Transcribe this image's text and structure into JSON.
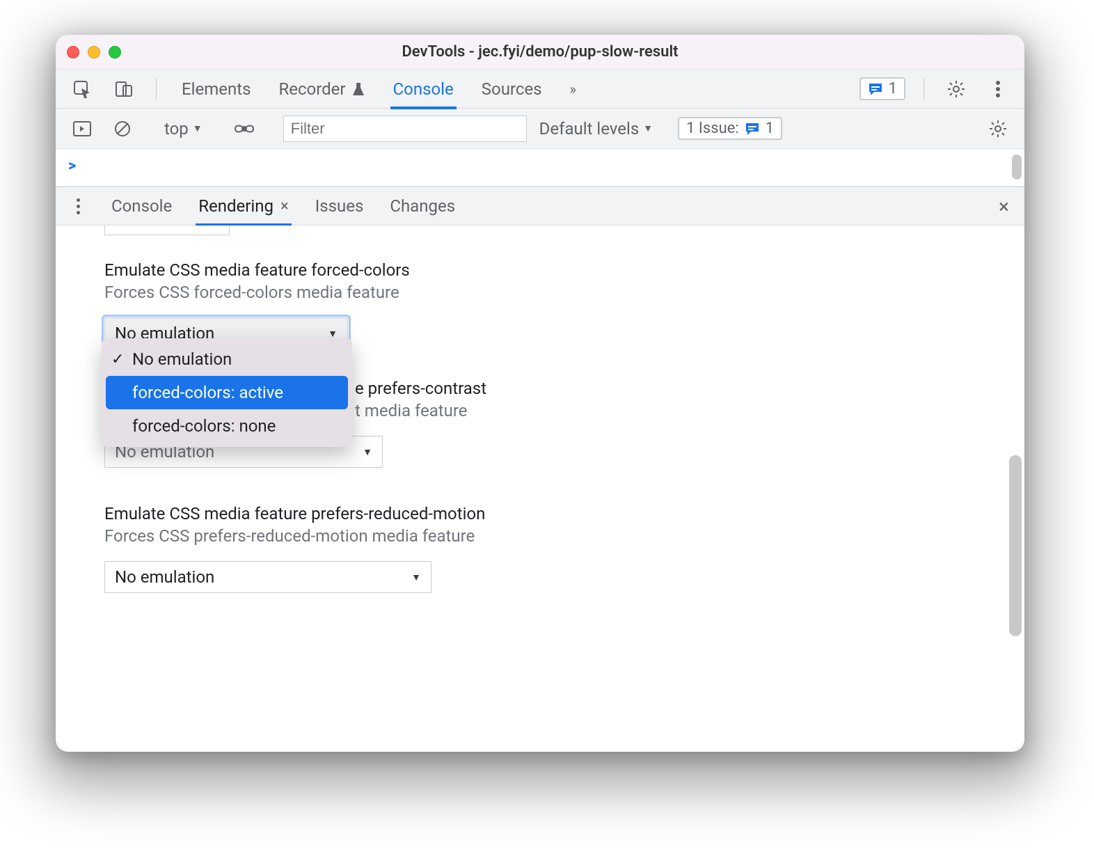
{
  "window": {
    "title": "DevTools - jec.fyi/demo/pup-slow-result"
  },
  "tabs": {
    "elements": "Elements",
    "recorder": "Recorder",
    "console": "Console",
    "sources": "Sources",
    "more_glyph": "»",
    "issues_count": "1"
  },
  "console_toolbar": {
    "context": "top",
    "filter_placeholder": "Filter",
    "levels": "Default levels",
    "issues_label": "1 Issue:",
    "issues_count": "1"
  },
  "drawer_tabs": {
    "console": "Console",
    "rendering": "Rendering",
    "issues": "Issues",
    "changes": "Changes"
  },
  "rendering": {
    "forced_colors": {
      "title": "Emulate CSS media feature forced-colors",
      "desc": "Forces CSS forced-colors media feature",
      "value": "No emulation",
      "options": [
        "No emulation",
        "forced-colors: active",
        "forced-colors: none"
      ],
      "selected_index": 0,
      "highlight_index": 1
    },
    "prefers_contrast": {
      "title_suffix": "e prefers-contrast",
      "desc_suffix": "t media feature",
      "value": "No emulation"
    },
    "prefers_reduced_motion": {
      "title": "Emulate CSS media feature prefers-reduced-motion",
      "desc": "Forces CSS prefers-reduced-motion media feature",
      "value": "No emulation"
    }
  },
  "glyphs": {
    "check": "✓",
    "triangle_down": "▼",
    "close": "×",
    "chevrons": "»",
    "caret": ">"
  },
  "colors": {
    "accent": "#1a73e8",
    "text": "#202124",
    "muted": "#5f6368",
    "panel": "#f1f3f4"
  }
}
